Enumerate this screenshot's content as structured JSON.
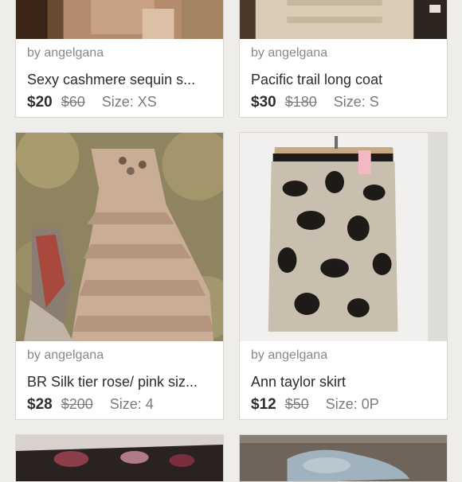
{
  "listings": [
    {
      "seller": "by angelgana",
      "title": "Sexy cashmere sequin s...",
      "price": "$20",
      "original_price": "$60",
      "size": "Size: XS"
    },
    {
      "seller": "by angelgana",
      "title": "Pacific trail long coat",
      "price": "$30",
      "original_price": "$180",
      "size": "Size: S"
    },
    {
      "seller": "by angelgana",
      "title": "BR Silk tier rose/ pink siz...",
      "price": "$28",
      "original_price": "$200",
      "size": "Size: 4"
    },
    {
      "seller": "by angelgana",
      "title": "Ann taylor skirt",
      "price": "$12",
      "original_price": "$50",
      "size": "Size: 0P"
    }
  ]
}
